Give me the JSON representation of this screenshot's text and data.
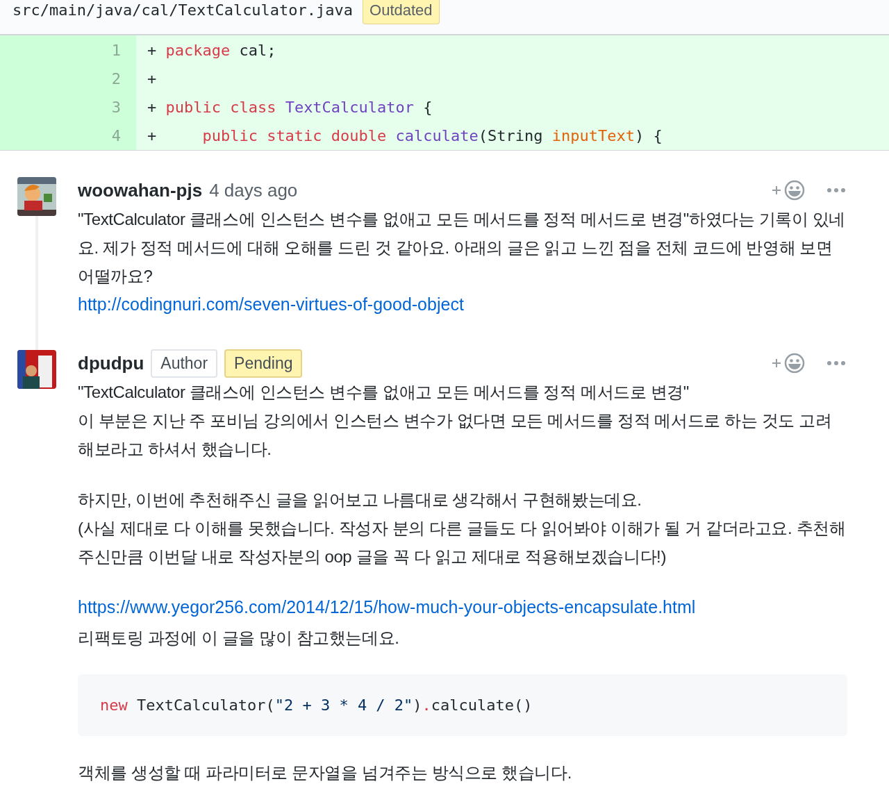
{
  "file_header": {
    "path": "src/main/java/cal/TextCalculator.java",
    "badge": "Outdated"
  },
  "diff_lines": [
    {
      "number": "1",
      "marker": "+",
      "tokens": [
        {
          "kind": "keyword",
          "text": "package"
        },
        {
          "kind": "plain",
          "text": " cal;"
        }
      ]
    },
    {
      "number": "2",
      "marker": "+"
    },
    {
      "number": "3",
      "marker": "+",
      "tokens": [
        {
          "kind": "keyword",
          "text": "public class"
        },
        {
          "kind": "type",
          "text": " TextCalculator"
        },
        {
          "kind": "plain",
          "text": " {"
        }
      ]
    },
    {
      "number": "4",
      "marker": "+",
      "tokens": [
        {
          "kind": "keyword",
          "text": "    public static double"
        },
        {
          "kind": "type",
          "text": " calculate"
        },
        {
          "kind": "plain",
          "text": "(String "
        },
        {
          "kind": "param",
          "text": "inputText"
        },
        {
          "kind": "plain",
          "text": ") {"
        }
      ]
    }
  ],
  "comments": [
    {
      "author": "woowahan-pjs",
      "time": "4 days ago",
      "body": [
        {
          "kind": "paragraph",
          "lines": [
            {
              "kind": "text",
              "text": "\"TextCalculator 클래스에 인스턴스 변수를 없애고 모든 메서드를 정적 메서드로 변경\"하였다는 기록이 있네요. 제가 정적 메서드에 대해 오해를 드린 것 같아요. 아래의 글은 읽고 느낀 점을 전체 코드에 반영해 보면 어떨까요?"
            },
            {
              "kind": "link",
              "text": "http://codingnuri.com/seven-virtues-of-good-object"
            }
          ]
        }
      ]
    },
    {
      "author": "dpudpu",
      "labels": [
        {
          "kind": "author",
          "text": "Author"
        },
        {
          "kind": "pending",
          "text": "Pending"
        }
      ],
      "body": [
        {
          "kind": "paragraph",
          "lines": [
            {
              "kind": "text",
              "text": "\"TextCalculator 클래스에 인스턴스 변수를 없애고 모든 메서드를 정적 메서드로 변경\""
            },
            {
              "kind": "text",
              "text": "이 부분은 지난 주 포비님 강의에서 인스턴스 변수가 없다면 모든 메서드를 정적 메서드로 하는 것도 고려해보라고 하셔서 했습니다."
            }
          ]
        },
        {
          "kind": "paragraph",
          "lines": [
            {
              "kind": "text",
              "text": "하지만, 이번에 추천해주신 글을 읽어보고 나름대로 생각해서 구현해봤는데요."
            },
            {
              "kind": "text",
              "text": "(사실 제대로 다 이해를 못했습니다. 작성자 분의 다른 글들도 다 읽어봐야 이해가 될 거 같더라고요. 추천해주신만큼 이번달 내로 작성자분의 oop 글을 꼭 다 읽고 제대로 적용해보겠습니다!)"
            }
          ]
        },
        {
          "kind": "paragraph",
          "lines": [
            {
              "kind": "link",
              "text": "https://www.yegor256.com/2014/12/15/how-much-your-objects-encapsulate.html"
            },
            {
              "kind": "text",
              "text": "리팩토링 과정에 이 글을 많이 참고했는데요."
            }
          ]
        },
        {
          "kind": "code",
          "tokens": [
            {
              "kind": "keyword",
              "text": "new"
            },
            {
              "kind": "plain",
              "text": " TextCalculator("
            },
            {
              "kind": "string",
              "text": "\"2 + 3 * 4 / 2\""
            },
            {
              "kind": "plain",
              "text": ")"
            },
            {
              "kind": "keyword",
              "text": "."
            },
            {
              "kind": "plain",
              "text": "calculate()"
            }
          ]
        },
        {
          "kind": "paragraph",
          "lines": [
            {
              "kind": "text",
              "text": "객체를 생성할 때 파라미터로 문자열을 넘겨주는 방식으로 했습니다."
            }
          ]
        }
      ]
    }
  ]
}
